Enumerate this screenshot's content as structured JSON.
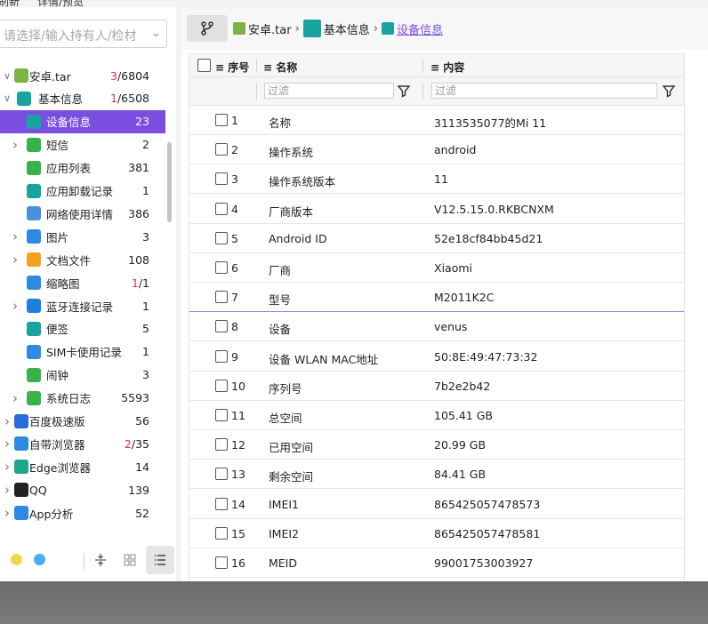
{
  "menu": {
    "items": [
      "刷新",
      "详情/预览"
    ]
  },
  "search": {
    "placeholder": "请选择/输入持有人/检材"
  },
  "tree": [
    {
      "label": "安卓.tar",
      "count_red": "3",
      "count_rest": "/6804",
      "icon": "android-icon",
      "color": "#7cb342",
      "level": 0,
      "expanded": true
    },
    {
      "label": "基本信息",
      "count_red": "1",
      "count_rest": "/6508",
      "icon": "basic-info-icon",
      "color": "#17a3a0",
      "level": 1,
      "expanded": true
    },
    {
      "label": "设备信息",
      "count_red": "",
      "count_rest": "23",
      "icon": "device-info-icon",
      "color": "#17a3a0",
      "level": 2,
      "selected": true
    },
    {
      "label": "短信",
      "count_red": "",
      "count_rest": "2",
      "icon": "sms-icon",
      "color": "#37b34a",
      "level": 2,
      "expandable": true
    },
    {
      "label": "应用列表",
      "count_red": "",
      "count_rest": "381",
      "icon": "app-list-icon",
      "color": "#37b34a",
      "level": 2
    },
    {
      "label": "应用卸载记录",
      "count_red": "",
      "count_rest": "1",
      "icon": "uninstall-record-icon",
      "color": "#17a3a0",
      "level": 2
    },
    {
      "label": "网络使用详情",
      "count_red": "",
      "count_rest": "386",
      "icon": "network-usage-icon",
      "color": "#4a90d9",
      "level": 2
    },
    {
      "label": "图片",
      "count_red": "",
      "count_rest": "3",
      "icon": "image-icon",
      "color": "#2d8ae0",
      "level": 2,
      "expandable": true
    },
    {
      "label": "文档文件",
      "count_red": "",
      "count_rest": "108",
      "icon": "document-icon",
      "color": "#f2a31b",
      "level": 2,
      "expandable": true
    },
    {
      "label": "缩略图",
      "count_red": "1",
      "count_rest": "/1",
      "icon": "thumbnail-icon",
      "color": "#2d8ae0",
      "level": 2
    },
    {
      "label": "蓝牙连接记录",
      "count_red": "",
      "count_rest": "1",
      "icon": "bluetooth-icon",
      "color": "#1f7fe0",
      "level": 2,
      "expandable": true
    },
    {
      "label": "便签",
      "count_red": "",
      "count_rest": "5",
      "icon": "note-icon",
      "color": "#17a3a0",
      "level": 2
    },
    {
      "label": "SIM卡使用记录",
      "count_red": "",
      "count_rest": "1",
      "icon": "sim-card-icon",
      "color": "#2d8ae0",
      "level": 2
    },
    {
      "label": "闹钟",
      "count_red": "",
      "count_rest": "3",
      "icon": "alarm-icon",
      "color": "#37b34a",
      "level": 2
    },
    {
      "label": "系统日志",
      "count_red": "",
      "count_rest": "5593",
      "icon": "system-log-icon",
      "color": "#37b34a",
      "level": 2,
      "expandable": true
    },
    {
      "label": "百度极速版",
      "count_red": "",
      "count_rest": "56",
      "icon": "baidu-icon",
      "color": "#2a6cd8",
      "level": 0,
      "expandable": true
    },
    {
      "label": "自带浏览器",
      "count_red": "2",
      "count_rest": "/35",
      "icon": "browser-icon",
      "color": "#2d8ae0",
      "level": 0,
      "expandable": true
    },
    {
      "label": "Edge浏览器",
      "count_red": "",
      "count_rest": "14",
      "icon": "edge-icon",
      "color": "#1fa58a",
      "level": 0,
      "expandable": true
    },
    {
      "label": "QQ",
      "count_red": "",
      "count_rest": "139",
      "icon": "qq-icon",
      "color": "#222222",
      "level": 0,
      "expandable": true
    },
    {
      "label": "App分析",
      "count_red": "",
      "count_rest": "52",
      "icon": "app-analysis-icon",
      "color": "#2d8ae0",
      "level": 0,
      "expandable": true
    }
  ],
  "breadcrumb": [
    {
      "label": "安卓.tar",
      "icon": "android-icon",
      "color": "#7cb342"
    },
    {
      "label": "基本信息",
      "icon": "basic-info-icon",
      "color": "#17a3a0"
    },
    {
      "label": "设备信息",
      "icon": "device-info-icon",
      "color": "#17a3a0",
      "current": true
    }
  ],
  "table": {
    "headers": {
      "seq": "序号",
      "name": "名称",
      "content": "内容"
    },
    "filter_placeholder": "过滤",
    "rows": [
      {
        "num": "1",
        "name": "名称",
        "value": "3113535077的Mi 11"
      },
      {
        "num": "2",
        "name": "操作系统",
        "value": "android"
      },
      {
        "num": "3",
        "name": "操作系统版本",
        "value": "11"
      },
      {
        "num": "4",
        "name": "厂商版本",
        "value": "V12.5.15.0.RKBCNXM"
      },
      {
        "num": "5",
        "name": "Android ID",
        "value": "52e18cf84bb45d21"
      },
      {
        "num": "6",
        "name": "厂商",
        "value": "Xiaomi"
      },
      {
        "num": "7",
        "name": "型号",
        "value": "M2011K2C"
      },
      {
        "num": "8",
        "name": "设备",
        "value": "venus"
      },
      {
        "num": "9",
        "name": "设备 WLAN MAC地址",
        "value": "50:8E:49:47:73:32"
      },
      {
        "num": "10",
        "name": "序列号",
        "value": "7b2e2b42"
      },
      {
        "num": "11",
        "name": "总空间",
        "value": "105.41 GB"
      },
      {
        "num": "12",
        "name": "已用空间",
        "value": "20.99 GB"
      },
      {
        "num": "13",
        "name": "剩余空间",
        "value": "84.41 GB"
      },
      {
        "num": "14",
        "name": "IMEI1",
        "value": "865425057478573"
      },
      {
        "num": "15",
        "name": "IMEI2",
        "value": "865425057478581"
      },
      {
        "num": "16",
        "name": "MEID",
        "value": "99001753003927"
      }
    ]
  },
  "colors": {
    "accent": "#7a4fe0",
    "dot_yellow": "#f7d548",
    "dot_blue": "#45aef0"
  }
}
